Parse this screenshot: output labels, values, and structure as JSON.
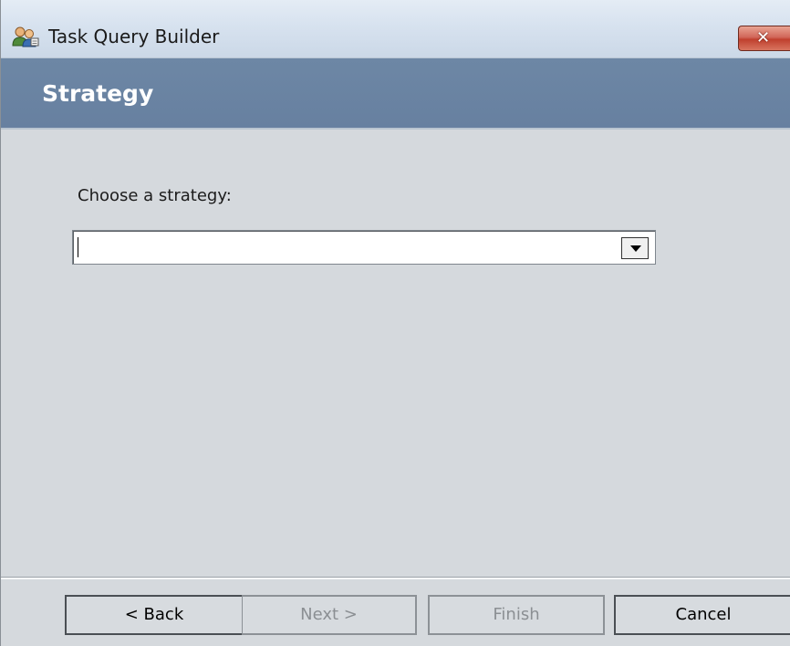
{
  "window": {
    "title": "Task Query Builder",
    "icon": "users-icon",
    "close_label": "✕"
  },
  "header": {
    "title": "Strategy"
  },
  "main": {
    "prompt_label": "Choose a strategy:",
    "strategy_combo": {
      "value": "",
      "options": []
    }
  },
  "footer": {
    "back_label": "< Back",
    "next_label": "Next >",
    "finish_label": "Finish",
    "cancel_label": "Cancel"
  },
  "colors": {
    "header_bg": "#6d87a5",
    "content_bg": "#d5d9dd",
    "close_red": "#c0402e"
  }
}
